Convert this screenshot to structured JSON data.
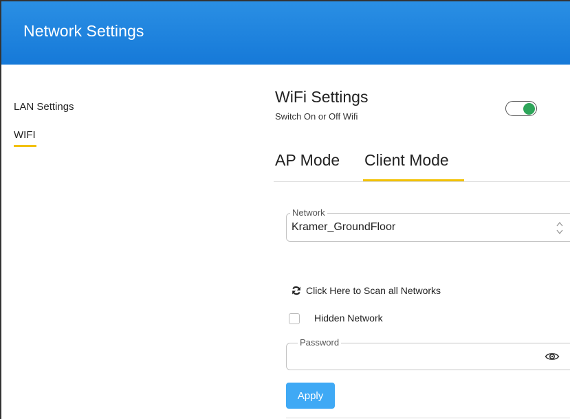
{
  "header": {
    "title": "Network Settings"
  },
  "sidebar": {
    "items": [
      {
        "label": "LAN Settings",
        "active": false
      },
      {
        "label": "WIFI",
        "active": true
      }
    ]
  },
  "wifi": {
    "title": "WiFi Settings",
    "subtitle": "Switch On or Off Wifi",
    "enabled": true
  },
  "tabs": [
    {
      "label": "AP Mode",
      "active": false
    },
    {
      "label": "Client Mode",
      "active": true
    }
  ],
  "form": {
    "network_label": "Network",
    "network_value": "Kramer_GroundFloor",
    "scan_label": "Click Here to Scan all Networks",
    "hidden_network_label": "Hidden Network",
    "hidden_network_checked": false,
    "password_label": "Password",
    "password_value": "",
    "apply_label": "Apply"
  },
  "colors": {
    "header": "#1679d8",
    "accent_underline": "#f2c100",
    "toggle_on": "#2ea55a",
    "apply_button": "#3fa9f5"
  }
}
